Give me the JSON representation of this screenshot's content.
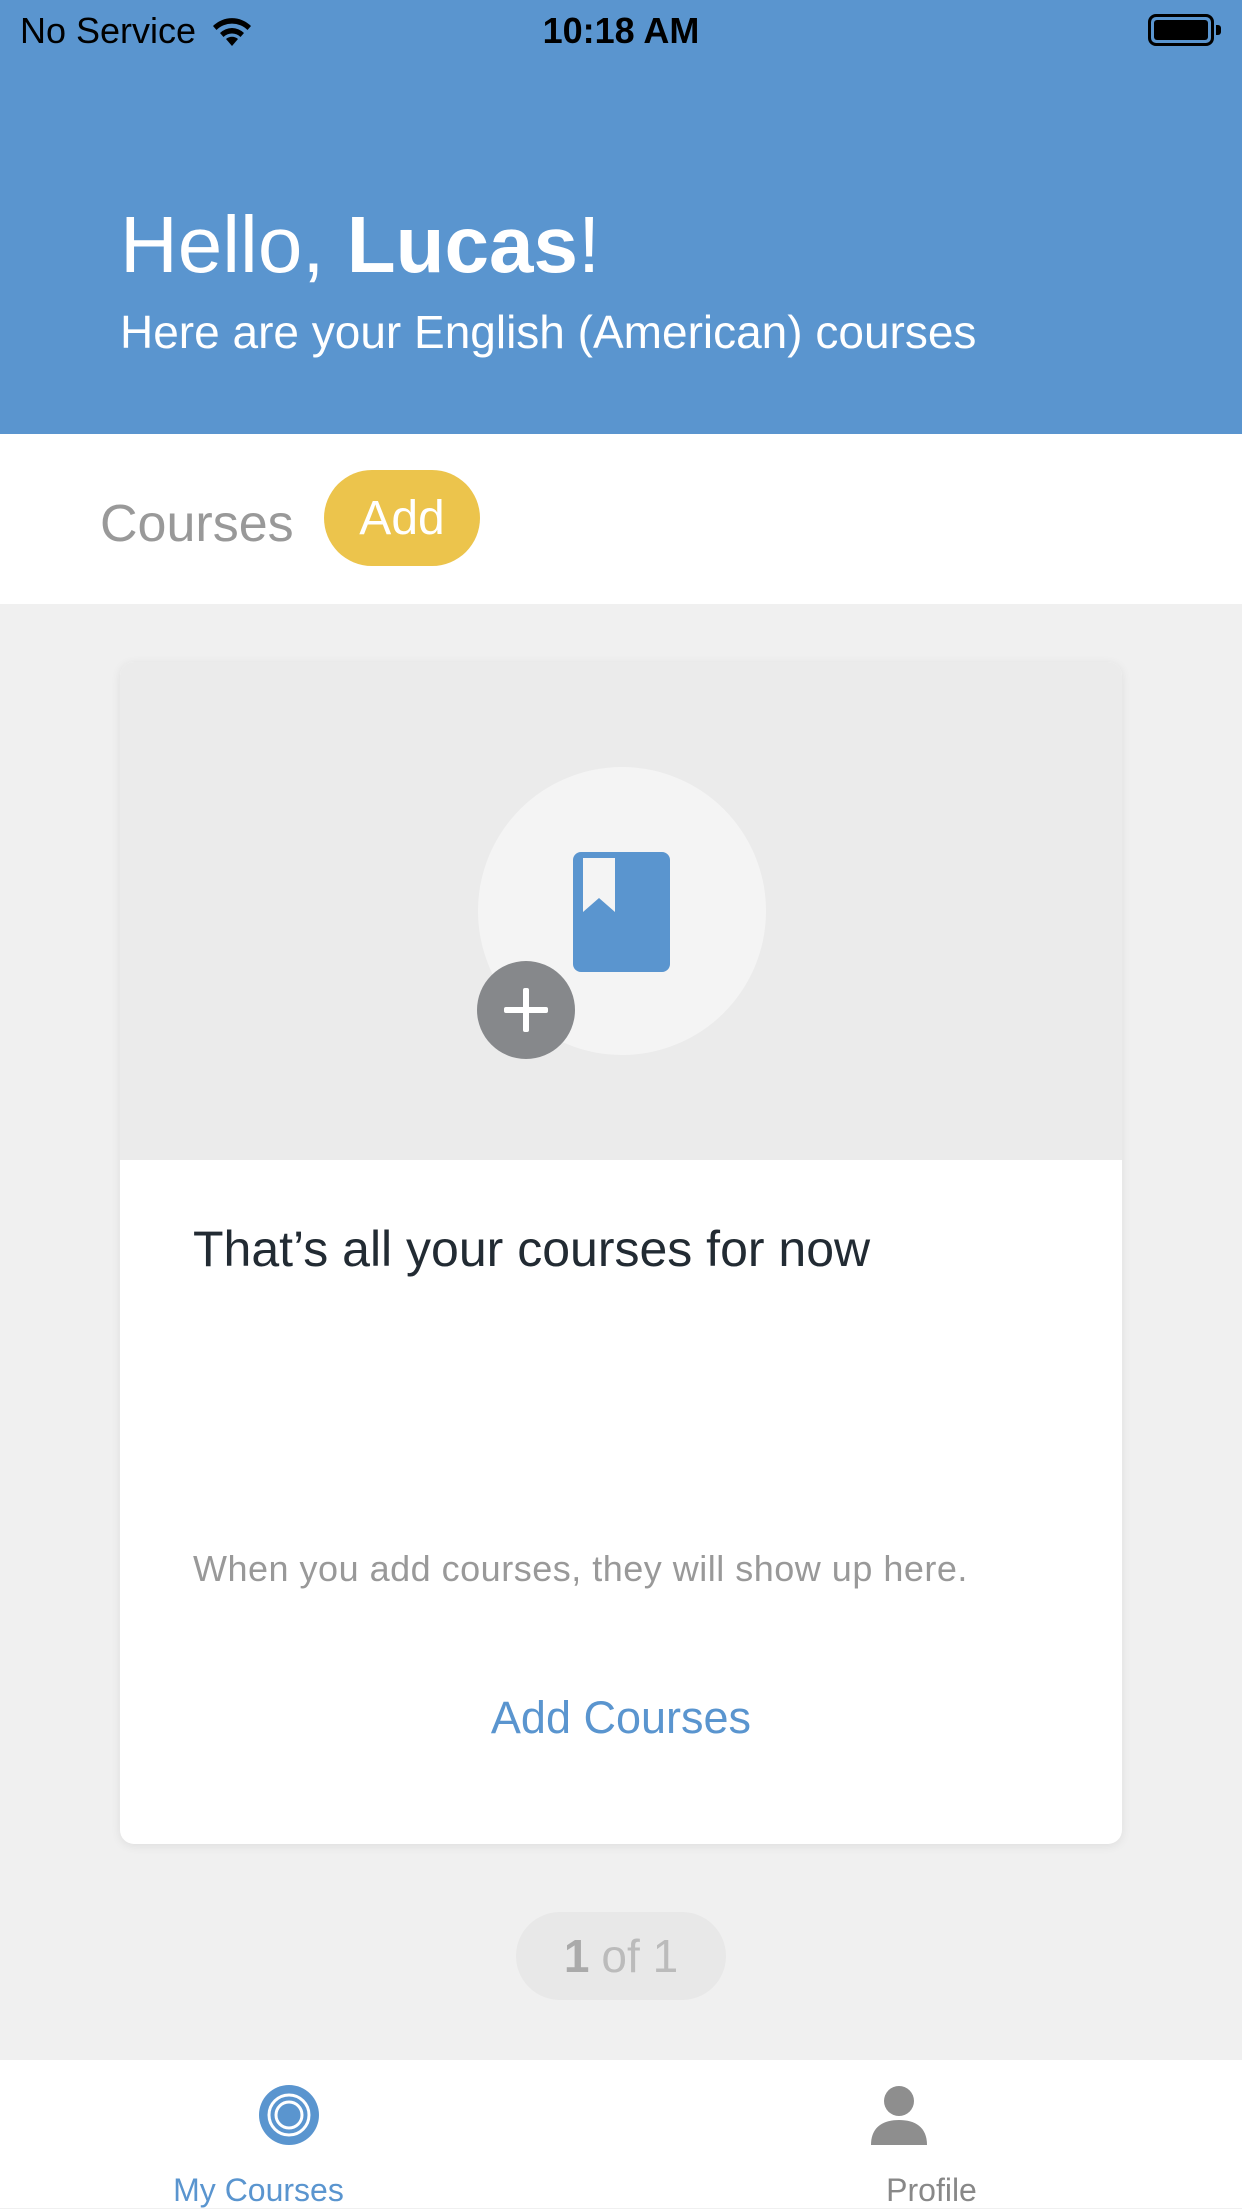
{
  "status_bar": {
    "carrier": "No Service",
    "time": "10:18 AM"
  },
  "header": {
    "greeting_prefix": "Hello, ",
    "user_name": "Lucas",
    "greeting_suffix": "!",
    "subtitle": "Here are your English (American) courses"
  },
  "tabs": {
    "courses_label": "Courses",
    "add_label": "Add"
  },
  "card": {
    "title": "That’s all your courses for now",
    "description": "When you add courses, they will show up here.",
    "action_label": "Add Courses",
    "icons": [
      "book-icon",
      "plus-icon"
    ]
  },
  "pager": {
    "current": "1",
    "of_total": "of 1"
  },
  "bottom_nav": {
    "items": [
      {
        "label": "My Courses",
        "icon": "target-icon",
        "active": true
      },
      {
        "label": "Profile",
        "icon": "person-icon",
        "active": false
      }
    ]
  },
  "colors": {
    "primary": "#5a95cf",
    "accent": "#ecc44c",
    "background": "#f0f0f0"
  }
}
